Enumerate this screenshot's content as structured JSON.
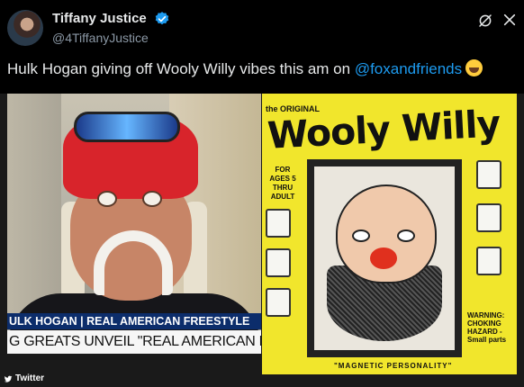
{
  "tweet": {
    "display_name": "Tiffany Justice",
    "handle": "@4TiffanyJustice",
    "text_before": "Hulk Hogan giving off Wooly Willy vibes this am on ",
    "mention": "@foxandfriends"
  },
  "icons": {
    "verified": "verified-badge-icon",
    "more": "grok-icon",
    "close": "close-icon",
    "emoji": "rolling-on-floor-laughing-emoji"
  },
  "media": {
    "left": {
      "lower_third_top": "ULK HOGAN | REAL AMERICAN FREESTYLE",
      "lower_third_bottom": "G GREATS UNVEIL \"REAL AMERICAN FREESTYL"
    },
    "right": {
      "the_original": "the ORIGINAL",
      "title": "Wooly Willy",
      "ages": "FOR AGES 5 THRU ADULT",
      "warning": "WARNING: CHOKING HAZARD - Small parts",
      "magnetic": "\"MAGNETIC PERSONALITY\""
    }
  },
  "watermark": "Twitter",
  "colors": {
    "background": "#000000",
    "text": "#e7e9ea",
    "secondary": "#8b98a5",
    "link": "#1d9bf0",
    "fox_blue": "#0c2d6b",
    "bandana_red": "#d8242b",
    "box_yellow": "#f1e62c"
  }
}
